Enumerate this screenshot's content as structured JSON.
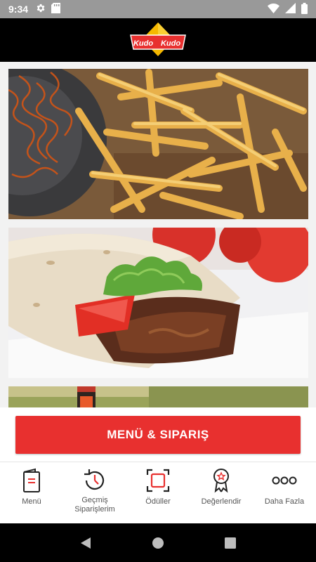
{
  "status_bar": {
    "time": "9:34",
    "left_icons": [
      "gear-icon",
      "sd-card-icon"
    ],
    "right_icons": [
      "wifi-icon",
      "signal-icon",
      "battery-icon"
    ]
  },
  "header": {
    "logo_text_left": "Kudo",
    "logo_text_right": "Kudo",
    "logo_colors": {
      "diamond": "#f5b800",
      "banner": "#e8302f"
    }
  },
  "feed": {
    "items": [
      {
        "name": "fries",
        "alt": "french fries"
      },
      {
        "name": "wrap",
        "alt": "doner wrap"
      },
      {
        "name": "drink",
        "alt": "drink"
      }
    ]
  },
  "cta": {
    "label": "MENÜ & SIPARIŞ",
    "color": "#e8302f"
  },
  "bottom_nav": {
    "items": [
      {
        "label": "Menü",
        "icon": "menu-book-icon"
      },
      {
        "label": "Geçmiş\nSiparişlerim",
        "icon": "history-icon"
      },
      {
        "label": "Ödüller",
        "icon": "rewards-icon"
      },
      {
        "label": "Değerlendir",
        "icon": "rating-badge-icon"
      },
      {
        "label": "Daha Fazla",
        "icon": "more-icon"
      }
    ]
  },
  "android_nav": {
    "buttons": [
      "back-icon",
      "home-icon",
      "recents-icon"
    ]
  }
}
